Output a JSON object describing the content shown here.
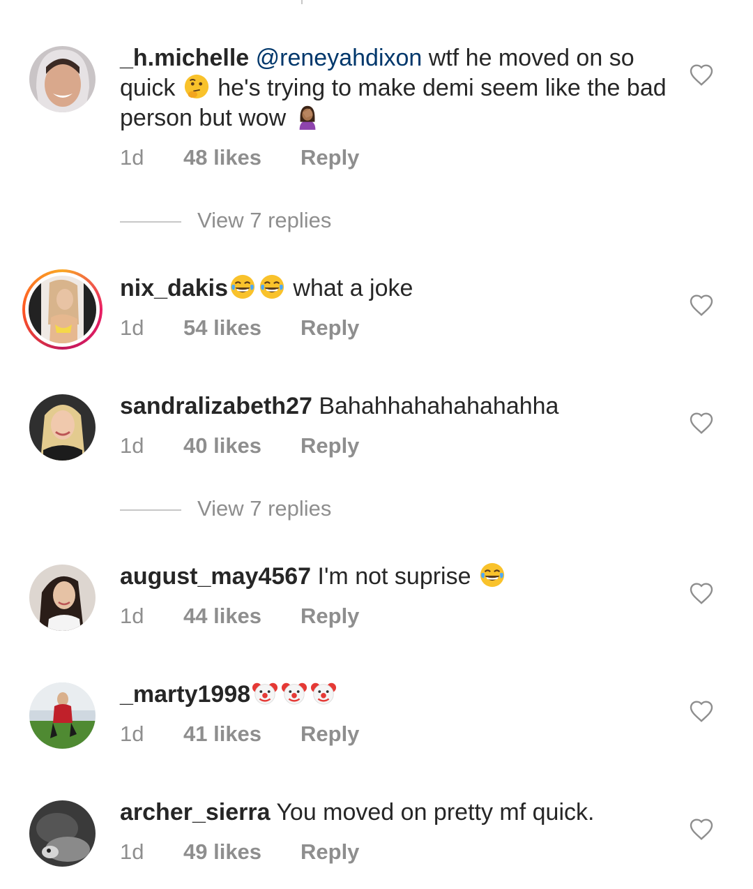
{
  "comments": [
    {
      "username": "_h.michelle",
      "mention": "@reneyahdixon",
      "text_before": " wtf he moved on so quick ",
      "emoji1": "thinking-face",
      "text_after": " he's trying to make demi seem like the bad person but wow ",
      "emoji2": "woman-facepalming",
      "time": "1d",
      "likes": "48 likes",
      "reply": "Reply"
    },
    {
      "username": "nix_dakis",
      "emoji": "face-with-tears-of-joy",
      "text": " what a joke",
      "time": "1d",
      "likes": "54 likes",
      "reply": "Reply"
    },
    {
      "username": "sandralizabeth27",
      "text": " Bahahhahahahahahha",
      "time": "1d",
      "likes": "40 likes",
      "reply": "Reply"
    },
    {
      "username": "august_may4567",
      "text": " I'm not suprise ",
      "emoji": "face-with-tears-of-joy",
      "time": "1d",
      "likes": "44 likes",
      "reply": "Reply"
    },
    {
      "username": "_marty1998",
      "emoji": "clown-face",
      "time": "1d",
      "likes": "41 likes",
      "reply": "Reply"
    },
    {
      "username": "archer_sierra",
      "text": " You moved on pretty mf quick.",
      "time": "1d",
      "likes": "49 likes",
      "reply": "Reply"
    }
  ],
  "view_replies": [
    "View 7 replies",
    "View 7 replies"
  ],
  "icons": {
    "like": "heart-outline-icon"
  },
  "colors": {
    "text": "#262626",
    "meta": "#8e8e8e",
    "mention": "#00376b"
  }
}
